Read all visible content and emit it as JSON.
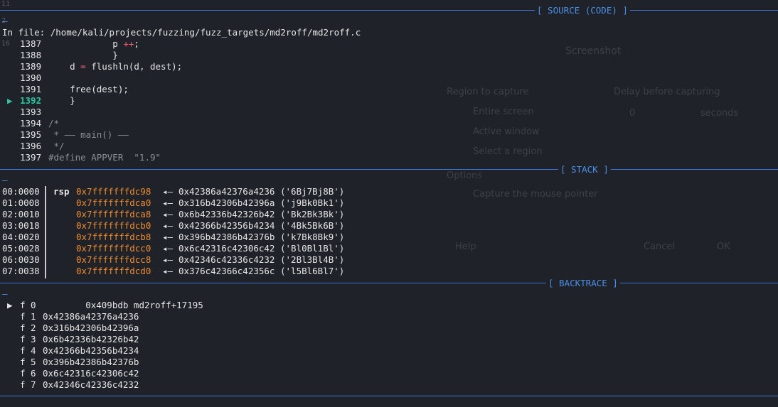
{
  "source_header": "[ SOURCE (CODE) ]",
  "stack_header": "[ STACK ]",
  "backtrace_header": "[ BACKTRACE ]",
  "dash": "—",
  "file_line": "In file: /home/kali/projects/fuzzing/fuzz_targets/md2roff/md2roff.c",
  "faded_numbers": [
    "11",
    "2",
    "16"
  ],
  "current_marker": "▶",
  "source_lines": [
    {
      "num": "1387",
      "parts": [
        {
          "t": "            p ",
          "c": ""
        },
        {
          "t": "++",
          "c": "op"
        },
        {
          "t": ";",
          "c": ""
        }
      ]
    },
    {
      "num": "1388",
      "parts": [
        {
          "t": "            }",
          "c": ""
        }
      ]
    },
    {
      "num": "1389",
      "parts": [
        {
          "t": "    d ",
          "c": ""
        },
        {
          "t": "=",
          "c": "op"
        },
        {
          "t": " flushln(d, dest);",
          "c": ""
        }
      ]
    },
    {
      "num": "1390",
      "parts": []
    },
    {
      "num": "1391",
      "parts": [
        {
          "t": "    free(dest);",
          "c": ""
        }
      ]
    },
    {
      "num": "1392",
      "current": true,
      "parts": [
        {
          "t": "    }",
          "c": ""
        }
      ]
    },
    {
      "num": "1393",
      "parts": []
    },
    {
      "num": "1394",
      "parts": [
        {
          "t": "/*",
          "c": "cmt"
        }
      ]
    },
    {
      "num": "1395",
      "parts": [
        {
          "t": " * —— main() ——",
          "c": "cmt"
        }
      ]
    },
    {
      "num": "1396",
      "parts": [
        {
          "t": " */",
          "c": "cmt"
        }
      ]
    },
    {
      "num": "1397",
      "parts": [
        {
          "t": "#define APPVER  \"1.9\"",
          "c": "cmt"
        }
      ]
    }
  ],
  "stack_rows": [
    {
      "off": "00:0000",
      "reg": "rsp",
      "addr": "0x7fffffffdc98",
      "arrow": "◂—",
      "val": "0x42386a42376a4236 ('6Bj7Bj8B')"
    },
    {
      "off": "01:0008",
      "reg": "",
      "addr": "0x7fffffffdca0",
      "arrow": "◂—",
      "val": "0x316b42306b42396a ('j9Bk0Bk1')"
    },
    {
      "off": "02:0010",
      "reg": "",
      "addr": "0x7fffffffdca8",
      "arrow": "◂—",
      "val": "0x6b42336b42326b42 ('Bk2Bk3Bk')"
    },
    {
      "off": "03:0018",
      "reg": "",
      "addr": "0x7fffffffdcb0",
      "arrow": "◂—",
      "val": "0x42366b42356b4234 ('4Bk5Bk6B')"
    },
    {
      "off": "04:0020",
      "reg": "",
      "addr": "0x7fffffffdcb8",
      "arrow": "◂—",
      "val": "0x396b42386b42376b ('k7Bk8Bk9')"
    },
    {
      "off": "05:0028",
      "reg": "",
      "addr": "0x7fffffffdcc0",
      "arrow": "◂—",
      "val": "0x6c42316c42306c42 ('Bl0Bl1Bl')"
    },
    {
      "off": "06:0030",
      "reg": "",
      "addr": "0x7fffffffdcc8",
      "arrow": "◂—",
      "val": "0x42346c42336c4232 ('2Bl3Bl4B')"
    },
    {
      "off": "07:0038",
      "reg": "",
      "addr": "0x7fffffffdcd0",
      "arrow": "◂—",
      "val": "0x376c42366c42356c ('l5Bl6Bl7')"
    }
  ],
  "backtrace": [
    {
      "marker": "▶",
      "frame": "f 0",
      "text": "        0x409bdb md2roff+17195"
    },
    {
      "marker": "",
      "frame": "f 1",
      "text": "0x42386a42376a4236"
    },
    {
      "marker": "",
      "frame": "f 2",
      "text": "0x316b42306b42396a"
    },
    {
      "marker": "",
      "frame": "f 3",
      "text": "0x6b42336b42326b42"
    },
    {
      "marker": "",
      "frame": "f 4",
      "text": "0x42366b42356b4234"
    },
    {
      "marker": "",
      "frame": "f 5",
      "text": "0x396b42386b42376b"
    },
    {
      "marker": "",
      "frame": "f 6",
      "text": "0x6c42316c42306c42"
    },
    {
      "marker": "",
      "frame": "f 7",
      "text": "0x42346c42336c4232"
    }
  ],
  "ghost_dialog": {
    "title": "Screenshot",
    "region_label": "Region to capture",
    "delay_label": "Delay before capturing",
    "entire_screen": "Entire screen",
    "active_window": "Active window",
    "select_region": "Select a region",
    "delay_value": "0",
    "seconds": "seconds",
    "options": "Options",
    "capture_pointer": "Capture the mouse pointer",
    "help": "Help",
    "cancel": "Cancel",
    "ok": "OK"
  },
  "colors": {
    "background": "#1f2229",
    "header": "#4a8fe7",
    "address": "#f08a2c",
    "current_line": "#2ec4a0",
    "operator": "#ff5a74",
    "comment": "#8a8f98"
  }
}
